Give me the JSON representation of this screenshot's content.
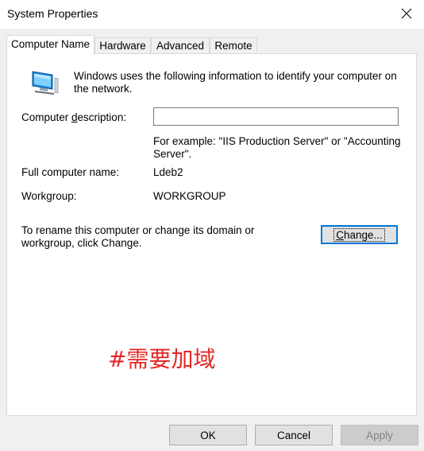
{
  "window": {
    "title": "System Properties"
  },
  "tabs": [
    {
      "label": "Computer Name",
      "active": true
    },
    {
      "label": "Hardware",
      "active": false
    },
    {
      "label": "Advanced",
      "active": false
    },
    {
      "label": "Remote",
      "active": false
    }
  ],
  "computer_name_tab": {
    "intro_line1": "Windows uses the following information to identify your computer on",
    "intro_line2": "the network.",
    "description_label_prefix": "Computer ",
    "description_label_accel": "d",
    "description_label_suffix": "escription:",
    "description_value": "",
    "example_line1": "For example: \"IIS Production Server\" or \"Accounting",
    "example_line2": "Server\".",
    "full_name_label": "Full computer name:",
    "full_name_value": "Ldeb2",
    "workgroup_label": "Workgroup:",
    "workgroup_value": "WORKGROUP",
    "rename_line1": "To rename this computer or change its domain or",
    "rename_line2": "workgroup, click Change.",
    "change_button_accel": "C",
    "change_button_rest": "hange..."
  },
  "annotation": "#需要加域",
  "footer": {
    "ok_label": "OK",
    "cancel_label": "Cancel",
    "apply_label": "Apply"
  },
  "icons": {
    "computer": "computer-icon",
    "close": "close-icon"
  },
  "colors": {
    "annotation": "#e32626",
    "focus_border": "#0078d7"
  }
}
